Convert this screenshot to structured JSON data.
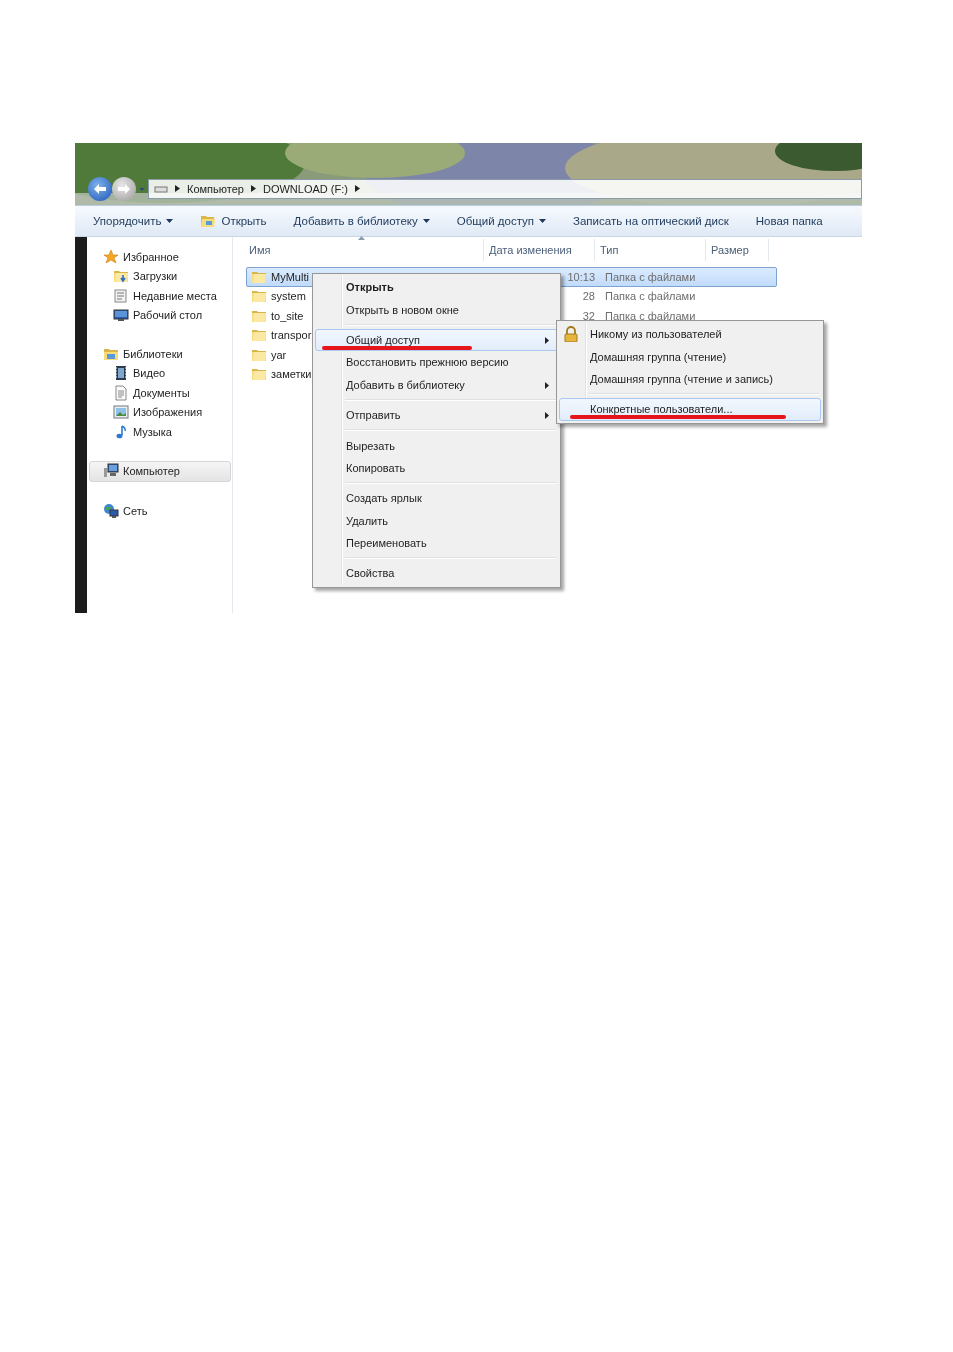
{
  "window": {
    "breadcrumb": [
      "Компьютер",
      "DOWNLOAD (F:)"
    ]
  },
  "toolbar": [
    {
      "label": "Упорядочить",
      "kind": "dropdown"
    },
    {
      "label": "Открыть",
      "kind": "open"
    },
    {
      "label": "Добавить в библиотеку",
      "kind": "dropdown"
    },
    {
      "label": "Общий доступ",
      "kind": "dropdown"
    },
    {
      "label": "Записать на оптический диск",
      "kind": "plain"
    },
    {
      "label": "Новая папка",
      "kind": "plain"
    }
  ],
  "sidebar": {
    "groups": [
      {
        "label": "Избранное",
        "kind": "star",
        "selected": false,
        "items": [
          {
            "label": "Загрузки",
            "kind": "downloads"
          },
          {
            "label": "Недавние места",
            "kind": "recent"
          },
          {
            "label": "Рабочий стол",
            "kind": "desktop"
          }
        ]
      },
      {
        "label": "Библиотеки",
        "kind": "library",
        "selected": false,
        "items": [
          {
            "label": "Видео",
            "kind": "video"
          },
          {
            "label": "Документы",
            "kind": "document"
          },
          {
            "label": "Изображения"
          },
          {
            "label": "Музыка",
            "kind": "music"
          }
        ]
      },
      {
        "label": "Компьютер",
        "kind": "computer",
        "selected": true
      },
      {
        "label": "Сеть",
        "kind": "network",
        "selected": false
      }
    ]
  },
  "table": {
    "columns": [
      {
        "label": "Имя",
        "sorted": true
      },
      {
        "label": "Дата изменения",
        "sorted": false
      },
      {
        "label": "Тип",
        "sorted": false
      },
      {
        "label": "Размер",
        "sorted": false
      }
    ],
    "rows": [
      {
        "name": "MyMulti",
        "date": "10:13",
        "type": "Папка с файлами",
        "selected": true
      },
      {
        "name": "system",
        "date": "28",
        "type": "Папка с файлами",
        "selected": false
      },
      {
        "name": "to_site",
        "date": "32",
        "type": "Папка с файлами",
        "selected": false
      },
      {
        "name": "transpor",
        "selected": false
      },
      {
        "name": "yar",
        "selected": false
      },
      {
        "name": "заметки",
        "selected": false
      }
    ]
  },
  "context_menu": {
    "items": [
      {
        "kind": "item",
        "label": "Открыть",
        "bold": true,
        "submenu": false,
        "selected": false,
        "underlined": false
      },
      {
        "kind": "item",
        "label": "Открыть в новом окне",
        "bold": false,
        "submenu": false,
        "selected": false,
        "underlined": false
      },
      {
        "kind": "separator"
      },
      {
        "kind": "item",
        "label": "Общий доступ",
        "bold": false,
        "submenu": true,
        "selected": true,
        "underlined": true
      },
      {
        "kind": "item",
        "label": "Восстановить прежнюю версию",
        "bold": false,
        "submenu": false,
        "selected": false,
        "underlined": false
      },
      {
        "kind": "item",
        "label": "Добавить в библиотеку",
        "bold": false,
        "submenu": true,
        "selected": false,
        "underlined": false
      },
      {
        "kind": "separator"
      },
      {
        "kind": "item",
        "label": "Отправить",
        "bold": false,
        "submenu": true,
        "selected": false,
        "underlined": false
      },
      {
        "kind": "separator"
      },
      {
        "kind": "item",
        "label": "Вырезать",
        "bold": false,
        "submenu": false,
        "selected": false,
        "underlined": false
      },
      {
        "kind": "item",
        "label": "Копировать",
        "bold": false,
        "submenu": false,
        "selected": false,
        "underlined": false
      },
      {
        "kind": "separator"
      },
      {
        "kind": "item",
        "label": "Создать ярлык",
        "bold": false,
        "submenu": false,
        "selected": false,
        "underlined": false
      },
      {
        "kind": "item",
        "label": "Удалить",
        "bold": false,
        "submenu": false,
        "selected": false,
        "underlined": false
      },
      {
        "kind": "item",
        "label": "Переименовать",
        "bold": false,
        "submenu": false,
        "selected": false,
        "underlined": false
      },
      {
        "kind": "separator"
      },
      {
        "kind": "item",
        "label": "Свойства",
        "bold": false,
        "submenu": false,
        "selected": false,
        "underlined": false
      }
    ]
  },
  "submenu": {
    "items": [
      {
        "kind": "lock",
        "label": "Никому из пользователей",
        "selected": false,
        "underlined": false
      },
      {
        "kind": "item",
        "label": "Домашняя группа (чтение)",
        "selected": false,
        "underlined": false
      },
      {
        "kind": "item",
        "label": "Домашняя группа (чтение и запись)",
        "selected": false,
        "underlined": false
      },
      {
        "kind": "separator"
      },
      {
        "kind": "item",
        "label": "Конкретные пользователи...",
        "selected": true,
        "underlined": true
      }
    ]
  }
}
